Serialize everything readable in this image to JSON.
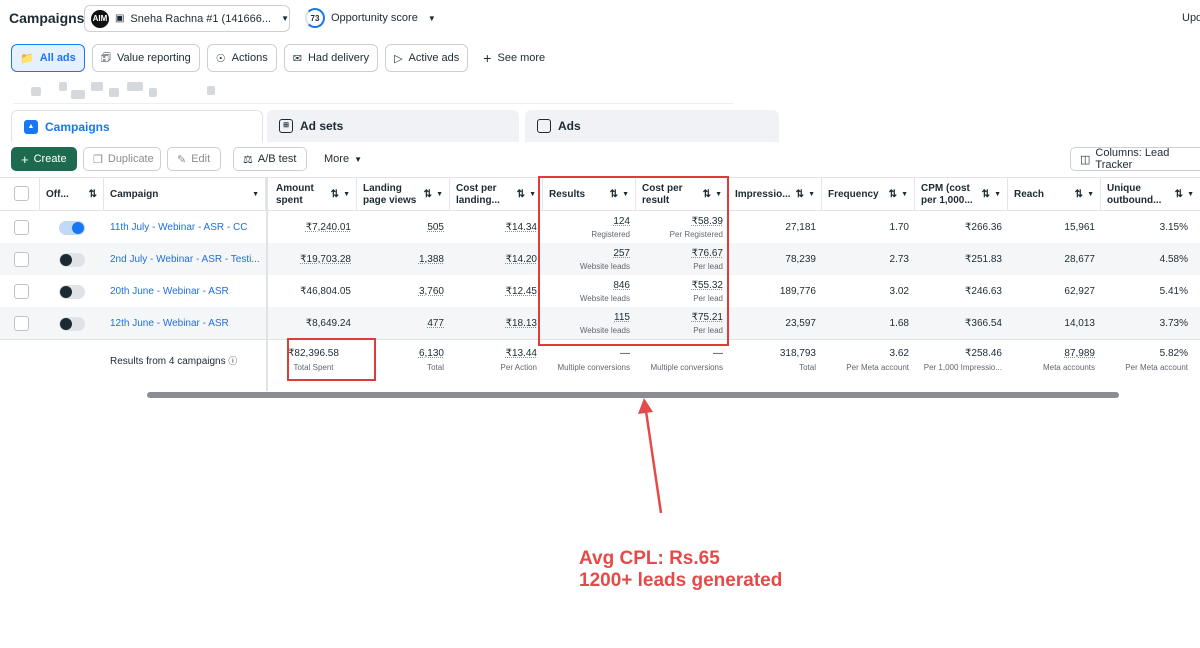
{
  "topbar": {
    "title": "Campaigns",
    "account_logo": "AIM",
    "account_name": "Sneha Rachna #1 (141666...",
    "opportunity_score": "73",
    "opportunity_label": "Opportunity score",
    "update_label": "Upd"
  },
  "filters": [
    "All ads",
    "Value reporting",
    "Actions",
    "Had delivery",
    "Active ads",
    "See more"
  ],
  "filter_icons": [
    "folder-icon",
    "report-icon",
    "actions-icon",
    "delivery-icon",
    "active-icon",
    "plus-icon"
  ],
  "tabs": {
    "campaigns": "Campaigns",
    "adsets": "Ad sets",
    "ads": "Ads"
  },
  "toolbar": {
    "create": "Create",
    "duplicate": "Duplicate",
    "edit": "Edit",
    "ab_test": "A/B test",
    "more": "More",
    "columns": "Columns: Lead Tracker"
  },
  "table": {
    "headers": {
      "off": "Off...",
      "campaign": "Campaign",
      "amount_spent": "Amount spent",
      "landing_page_views": "Landing page views",
      "cost_per_landing": "Cost per landing...",
      "results": "Results",
      "cost_per_result": "Cost per result",
      "impressions": "Impressio...",
      "frequency": "Frequency",
      "cpm": "CPM (cost per 1,000...",
      "reach": "Reach",
      "unique_outbound": "Unique outbound..."
    },
    "rows": [
      {
        "on": true,
        "campaign": "11th July - Webinar - ASR - CC",
        "amount_spent": "₹7,240.01",
        "landing_page_views": "505",
        "cost_per_landing": "₹14.34",
        "results": "124",
        "results_sub": "Registered",
        "cost_per_result": "₹58.39",
        "cost_per_result_sub": "Per Registered",
        "impressions": "27,181",
        "frequency": "1.70",
        "cpm": "₹266.36",
        "reach": "15,961",
        "unique_outbound": "3.15%"
      },
      {
        "on": false,
        "campaign": "2nd July - Webinar - ASR - Testi...",
        "amount_spent": "₹19,703.28",
        "landing_page_views": "1,388",
        "cost_per_landing": "₹14.20",
        "results": "257",
        "results_sub": "Website leads",
        "cost_per_result": "₹76.67",
        "cost_per_result_sub": "Per lead",
        "impressions": "78,239",
        "frequency": "2.73",
        "cpm": "₹251.83",
        "reach": "28,677",
        "unique_outbound": "4.58%"
      },
      {
        "on": false,
        "campaign": "20th June - Webinar - ASR",
        "amount_spent": "₹46,804.05",
        "landing_page_views": "3,760",
        "cost_per_landing": "₹12.45",
        "results": "846",
        "results_sub": "Website leads",
        "cost_per_result": "₹55.32",
        "cost_per_result_sub": "Per lead",
        "impressions": "189,776",
        "frequency": "3.02",
        "cpm": "₹246.63",
        "reach": "62,927",
        "unique_outbound": "5.41%"
      },
      {
        "on": false,
        "campaign": "12th June - Webinar - ASR",
        "amount_spent": "₹8,649.24",
        "landing_page_views": "477",
        "cost_per_landing": "₹18.13",
        "results": "115",
        "results_sub": "Website leads",
        "cost_per_result": "₹75.21",
        "cost_per_result_sub": "Per lead",
        "impressions": "23,597",
        "frequency": "1.68",
        "cpm": "₹366.54",
        "reach": "14,013",
        "unique_outbound": "3.73%"
      }
    ],
    "totals": {
      "label": "Results from 4 campaigns",
      "amount_spent": "₹82,396.58",
      "amount_spent_sub": "Total Spent",
      "landing_page_views": "6,130",
      "landing_page_views_sub": "Total",
      "cost_per_landing": "₹13.44",
      "cost_per_landing_sub": "Per Action",
      "results": "—",
      "results_sub": "Multiple conversions",
      "cost_per_result": "—",
      "cost_per_result_sub": "Multiple conversions",
      "impressions": "318,793",
      "impressions_sub": "Total",
      "frequency": "3.62",
      "frequency_sub": "Per Meta account",
      "cpm": "₹258.46",
      "cpm_sub": "Per 1,000 Impressio...",
      "reach": "87,989",
      "reach_sub": "Meta accounts",
      "unique_outbound": "5.82%",
      "unique_outbound_sub": "Per Meta account"
    }
  },
  "annotation": {
    "line1": "Avg CPL: Rs.65",
    "line2": "1200+ leads generated",
    "color": "#e34b4b"
  },
  "colors": {
    "accent": "#1877f2",
    "create_button": "#1d6b4f",
    "campaign_link": "#216fdb",
    "highlight_box": "#e03b3b"
  }
}
